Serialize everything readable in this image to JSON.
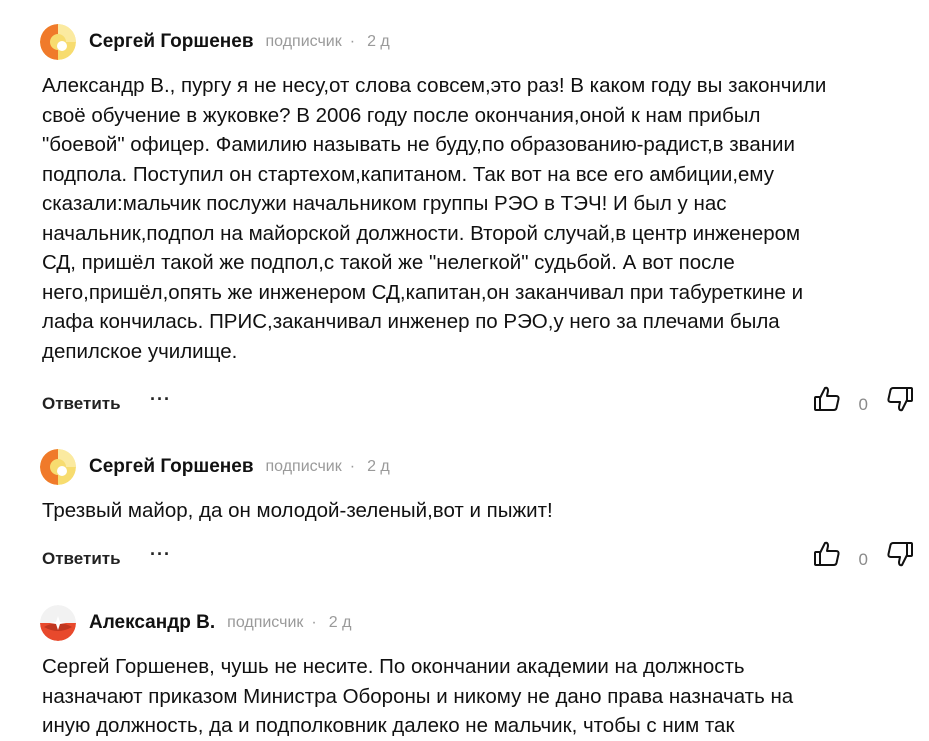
{
  "comments": [
    {
      "author": "Сергей Горшенев",
      "role": "подписчик",
      "separator": "·",
      "time": "2 д",
      "lines": [
        "Александр В., пургу я не несу,от слова совсем,это раз! В каком году вы закончили",
        "своё обучение в жуковке? В 2006 году после окончания,оной к нам прибыл",
        "\"боевой\" офицер. Фамилию называть не буду,по образованию-радист,в звании",
        "подпола. Поступил он стартехом,капитаном. Так вот на все его амбиции,ему",
        "сказали:мальчик послужи начальником группы РЭО в ТЭЧ! И был у нас",
        "начальник,подпол на майорской должности. Второй случай,в центр инженером",
        "СД, пришёл такой же подпол,с такой же \"нелегкой\" судьбой. А вот после",
        "него,пришёл,опять же инженером СД,капитан,он заканчивал при табуреткине и",
        "лафа кончилась. ПРИС,заканчивал инженер по РЭО,у него за плечами была",
        "депилское училище."
      ],
      "reply_label": "Ответить",
      "more_label": "···",
      "likes": "0"
    },
    {
      "author": "Сергей Горшенев",
      "role": "подписчик",
      "separator": "·",
      "time": "2 д",
      "lines": [
        "Трезвый майор, да он молодой-зеленый,вот и пыжит!"
      ],
      "reply_label": "Ответить",
      "more_label": "···",
      "likes": "0"
    },
    {
      "author": "Александр В.",
      "role": "подписчик",
      "separator": "·",
      "time": "2 д",
      "lines": [
        "Сергей Горшенев, чушь не несите. По окончании академии на должность",
        "назначают приказом Министра Обороны и никому не дано права назначать на",
        "иную должность, да и подполковник далеко не мальчик, чтобы с ним так"
      ]
    }
  ],
  "icons": {
    "like": "thumbs-up-icon",
    "dislike": "thumbs-down-icon",
    "avatar_sergey": "avatar-orange-yellow",
    "avatar_alexander": "avatar-red-white"
  },
  "colors": {
    "orange": "#f07a2a",
    "yellow": "#f7dc6f",
    "red": "#e8492c",
    "muted": "#9a9a9a"
  }
}
